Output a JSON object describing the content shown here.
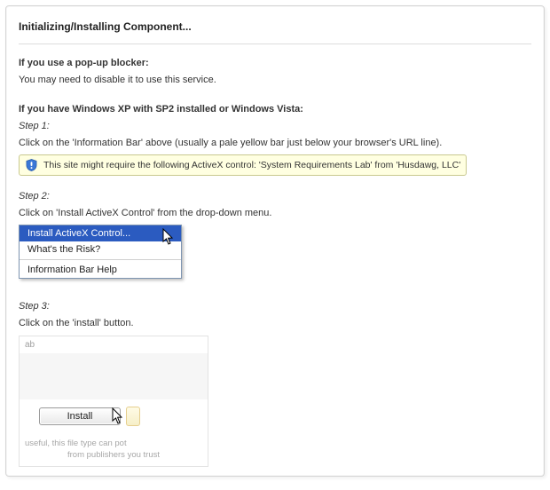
{
  "title": "Initializing/Installing Component...",
  "popup": {
    "heading": "If you use a pop-up blocker:",
    "text": "You may need to disable it to use this service."
  },
  "xp": {
    "heading": "If you have Windows XP with SP2 installed or Windows Vista:",
    "step1_label": "Step 1:",
    "step1_text": "Click on the 'Information Bar' above (usually a pale yellow bar just below your browser's URL line).",
    "infobar_text": "This site might require the following ActiveX control: 'System Requirements Lab' from 'Husdawg, LLC'",
    "step2_label": "Step 2:",
    "step2_text": "Click on 'Install ActiveX Control' from the drop-down menu.",
    "menu": {
      "install": "Install ActiveX Control...",
      "risk": "What's the Risk?",
      "help": "Information Bar Help"
    },
    "step3_label": "Step 3:",
    "step3_text": "Click on the 'install' button.",
    "install_top": "ab",
    "install_button": "Install",
    "install_footer_l1": "useful, this file type can pot",
    "install_footer_l2": "from publishers you trust"
  }
}
